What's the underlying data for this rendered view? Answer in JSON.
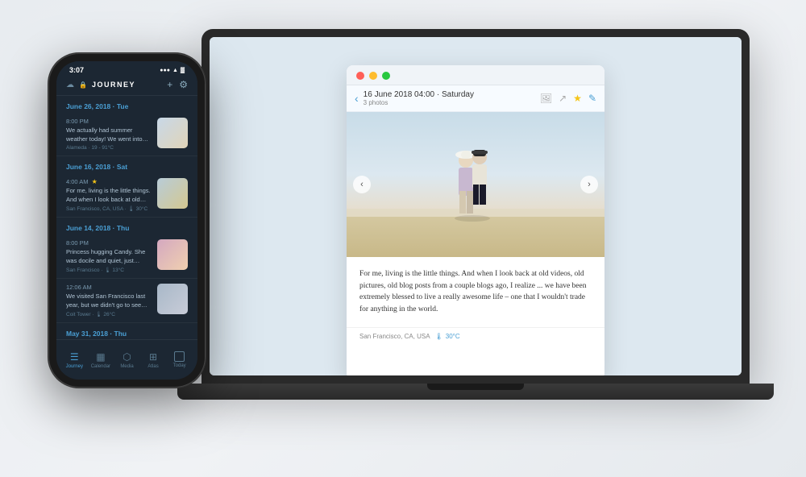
{
  "background_color": "#f0f2f5",
  "app": {
    "name": "JouRNey",
    "title_display": "JOURNEY"
  },
  "phone": {
    "status_bar": {
      "time": "3:07",
      "signal": "●●●",
      "wifi": "▲",
      "battery": "▓"
    },
    "header": {
      "cloud_icon": "☁",
      "lock_icon": "🔒",
      "title": "JOURNEY",
      "add_icon": "+",
      "settings_icon": "⚙"
    },
    "entries": [
      {
        "date_header": "June 26, 2018 · Tue",
        "time": "8:00 PM",
        "excerpt": "We actually had summer weather today! We went into town for a stroll, and I pic...",
        "location": "Alameda · 19 - 91°C",
        "weather": "🌡",
        "has_thumbnail": true,
        "thumb_type": "beach",
        "starred": false
      },
      {
        "date_header": "June 16, 2018 · Sat",
        "time": "4:00 AM",
        "excerpt": "For me, living is the little things. And when I look back at old videos, old ...",
        "location": "San Francisco, CA, USA · 🌡 30°C",
        "has_thumbnail": true,
        "thumb_type": "beach2",
        "starred": true
      },
      {
        "date_header": "June 14, 2018 · Thu",
        "time": "8:00 PM",
        "excerpt": "Princess hugging Candy. She was docile and quiet, just settling into her arms wi...",
        "location": "San Francisco · 🌡 13°C",
        "has_thumbnail": true,
        "thumb_type": "girl",
        "starred": false
      },
      {
        "date_header": "",
        "time": "12:06 AM",
        "excerpt": "We visited San Francisco last year, but we didn't go to see the Golden Gate Brid...",
        "location": "Coit Tower · 🌡 26°C",
        "has_thumbnail": true,
        "thumb_type": "bridge",
        "starred": false
      },
      {
        "date_header": "May 31, 2018 · Thu",
        "time": "",
        "excerpt": "",
        "location": "",
        "has_thumbnail": false,
        "thumb_type": "",
        "starred": false
      }
    ],
    "bottom_nav": [
      {
        "label": "Journey",
        "icon": "☰",
        "active": true
      },
      {
        "label": "Calendar",
        "icon": "▦",
        "active": false
      },
      {
        "label": "Media",
        "icon": "⬡",
        "active": false
      },
      {
        "label": "Atlas",
        "icon": "⊞",
        "active": false
      },
      {
        "label": "Today",
        "icon": "◻",
        "active": false
      }
    ]
  },
  "laptop": {
    "journal_window": {
      "header": {
        "date": "16 June 2018 04:00 · Saturday",
        "photos_count": "3 photos",
        "back_icon": "‹",
        "image_icon": "🖼",
        "share_icon": "↗",
        "star_icon": "★",
        "edit_icon": "✎"
      },
      "photo_nav": {
        "left_arrow": "‹",
        "right_arrow": "›"
      },
      "body_text": "For me, living is the little things. And when I look back at old videos, old pictures, old blog posts from a couple blogs ago, I realize ... we have been extremely blessed to live a really awesome life – one that I wouldn't trade for anything in the world.",
      "meta": {
        "location": "San Francisco, CA, USA",
        "weather_icon": "🌡",
        "temperature": "30°C"
      }
    }
  }
}
